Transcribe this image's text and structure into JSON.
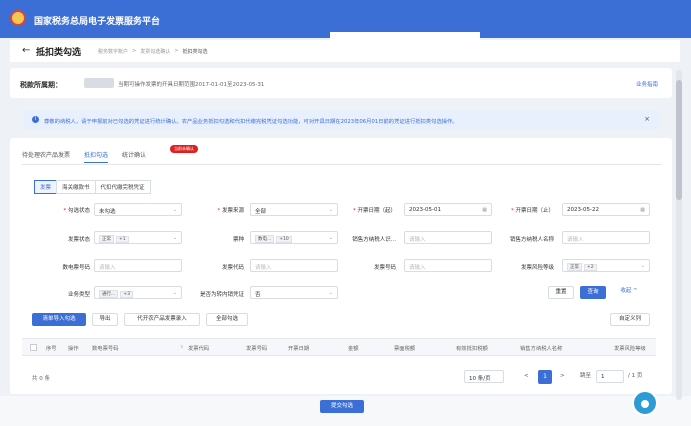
{
  "app": {
    "title": "国家税务总局电子发票服务平台"
  },
  "page": {
    "title": "抵扣类勾选",
    "back": "←"
  },
  "breadcrumb": [
    "税务数字账户",
    "发票勾选确认",
    "抵扣类勾选"
  ],
  "period": {
    "label": "税款所属期：",
    "note": "当期可操作发票的开具日期范围2017-01-01至2023-05-31",
    "link": "业务指南"
  },
  "notice": {
    "text": "尊敬的纳税人，请于申报前对已勾选的凭证进行统计确认。农产品业务抵扣勾选和代扣代缴完税凭证勾选功能，可对开具日期在2023年06月01日前的凭证进行抵扣类勾选操作。",
    "close": "×"
  },
  "tabs": [
    "待处理农产品发票",
    "抵扣勾选",
    "统计确认"
  ],
  "tab_badge": "当前未确认",
  "subtabs": [
    "发票",
    "海关缴款书",
    "代扣代缴完税凭证"
  ],
  "form": {
    "r1": [
      {
        "label": "勾选状态",
        "required": true,
        "value": "未勾选"
      },
      {
        "label": "发票来源",
        "required": true,
        "value": "全部"
      },
      {
        "label": "开票日期（起）",
        "required": true,
        "value": "2023-05-01"
      },
      {
        "label": "开票日期（止）",
        "required": true,
        "value": "2023-05-22"
      }
    ],
    "r2": [
      {
        "label": "发票状态",
        "chips": [
          "正常",
          "+1"
        ]
      },
      {
        "label": "票种",
        "chips": [
          "数电...",
          "+10"
        ]
      },
      {
        "label": "销售方纳税人识...",
        "placeholder": "请输入"
      },
      {
        "label": "销售方纳税人名称",
        "placeholder": "请输入"
      }
    ],
    "r3": [
      {
        "label": "数电票号码",
        "placeholder": "请输入"
      },
      {
        "label": "发票代码",
        "placeholder": "请输入"
      },
      {
        "label": "发票号码",
        "placeholder": "请输入"
      },
      {
        "label": "发票风险等级",
        "chips": [
          "正常",
          "+2"
        ]
      }
    ],
    "r4": [
      {
        "label": "业务类型",
        "chips": [
          "通行...",
          "+3"
        ]
      },
      {
        "label": "是否为转内销凭证",
        "value": "否"
      }
    ],
    "reset": "重置",
    "query": "查询",
    "collapse": "收起 ^"
  },
  "toolbar": {
    "import": "清单导入勾选",
    "export": "导出",
    "agri": "代开农产品发票录入",
    "all": "全部勾选",
    "custom": "自定义列"
  },
  "table": {
    "headers": [
      "序号",
      "操作",
      "数电票号码",
      "发票代码",
      "发票号码",
      "开票日期",
      "金额",
      "票面税额",
      "有效抵扣税额",
      "销售方纳税人名称",
      "发票风险等级"
    ]
  },
  "pagination": {
    "total": "共 0 条",
    "size": "10 条/页",
    "prev": "<",
    "current": "1",
    "next": ">",
    "goto": "跳至",
    "page": "1",
    "pages": "/ 1 页"
  },
  "footer": {
    "submit": "提交勾选"
  }
}
